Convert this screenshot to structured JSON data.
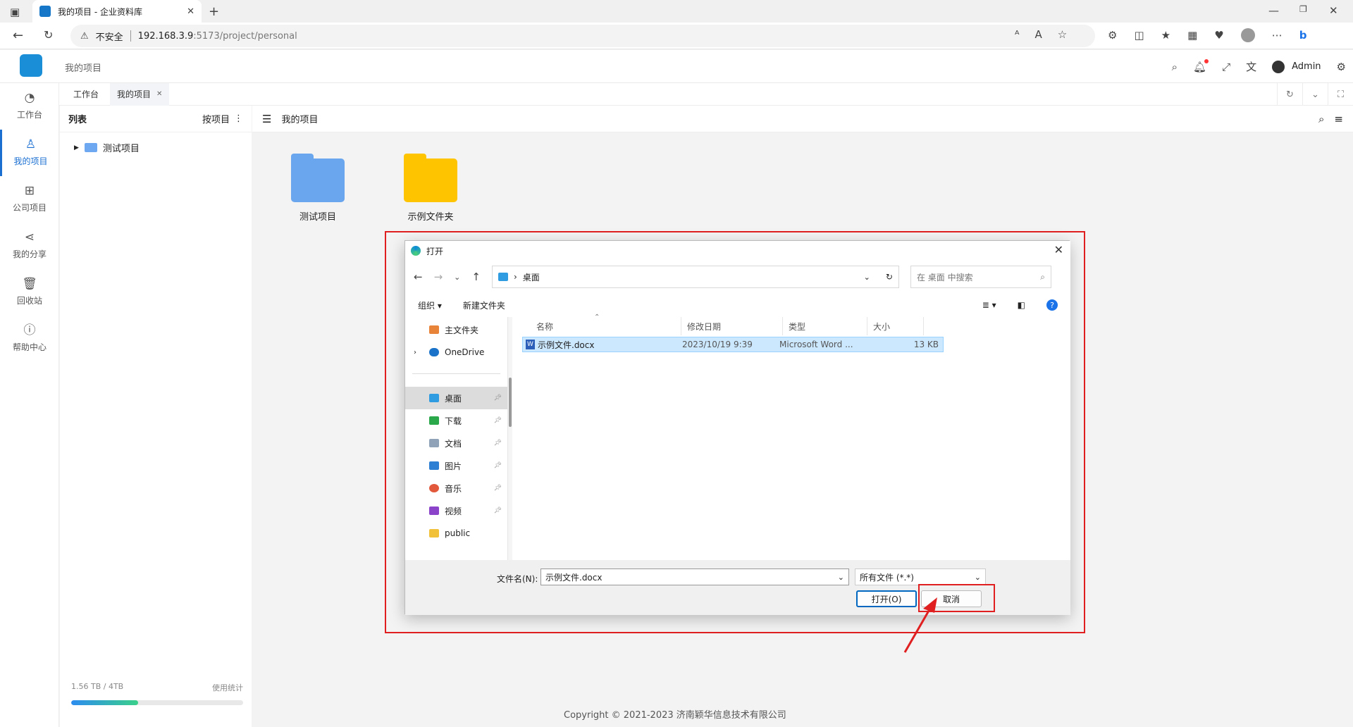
{
  "browser": {
    "tab_title": "我的项目 - 企业资料库",
    "insecure_label": "不安全",
    "url_host": "192.168.3.9",
    "url_rest": ":5173/project/personal"
  },
  "header": {
    "breadcrumb": "我的项目",
    "user": "Admin"
  },
  "nav": {
    "items": [
      {
        "label": "工作台",
        "icon": "dashboard-icon"
      },
      {
        "label": "我的项目",
        "icon": "user-icon",
        "active": true
      },
      {
        "label": "公司项目",
        "icon": "org-icon"
      },
      {
        "label": "我的分享",
        "icon": "share-icon"
      },
      {
        "label": "回收站",
        "icon": "trash-icon"
      },
      {
        "label": "帮助中心",
        "icon": "help-icon"
      }
    ]
  },
  "tags": {
    "workbench": "工作台",
    "current": "我的项目"
  },
  "tree": {
    "header": "列表",
    "sort": "按项目",
    "node": "测试项目"
  },
  "usage": {
    "amount": "1.56 TB / 4TB",
    "stats": "使用统计",
    "fraction": 0.39
  },
  "content": {
    "title": "我的项目",
    "folders": [
      {
        "name": "测试项目",
        "color": "#6aa6ee"
      },
      {
        "name": "示例文件夹",
        "color": "#ffc400"
      }
    ],
    "copyright": "Copyright © 2021-2023 济南颖华信息技术有限公司"
  },
  "dialog": {
    "title": "打开",
    "path": "桌面",
    "search_placeholder": "在 桌面 中搜索",
    "organize": "组织 ▾",
    "new_folder": "新建文件夹",
    "nav_items": [
      {
        "label": "主文件夹",
        "color": "#e8833a"
      },
      {
        "label": "OneDrive",
        "color": "#1a73c8"
      },
      {
        "label": "桌面",
        "color": "#2f9be0",
        "selected": true,
        "pinned": true
      },
      {
        "label": "下载",
        "color": "#2ba84a",
        "pinned": true
      },
      {
        "label": "文档",
        "color": "#8fa2b8",
        "pinned": true
      },
      {
        "label": "图片",
        "color": "#2d7fd3",
        "pinned": true
      },
      {
        "label": "音乐",
        "color": "#e2583b",
        "pinned": true
      },
      {
        "label": "视频",
        "color": "#8a43c9",
        "pinned": true
      },
      {
        "label": "public",
        "color": "#f2c13a"
      }
    ],
    "columns": [
      "名称",
      "修改日期",
      "类型",
      "大小"
    ],
    "file": {
      "name": "示例文件.docx",
      "date": "2023/10/19 9:39",
      "type": "Microsoft Word ...",
      "size": "13 KB"
    },
    "filename_label": "文件名(N):",
    "filename_value": "示例文件.docx",
    "filetype": "所有文件 (*.*)",
    "open": "打开(O)",
    "cancel": "取消"
  }
}
